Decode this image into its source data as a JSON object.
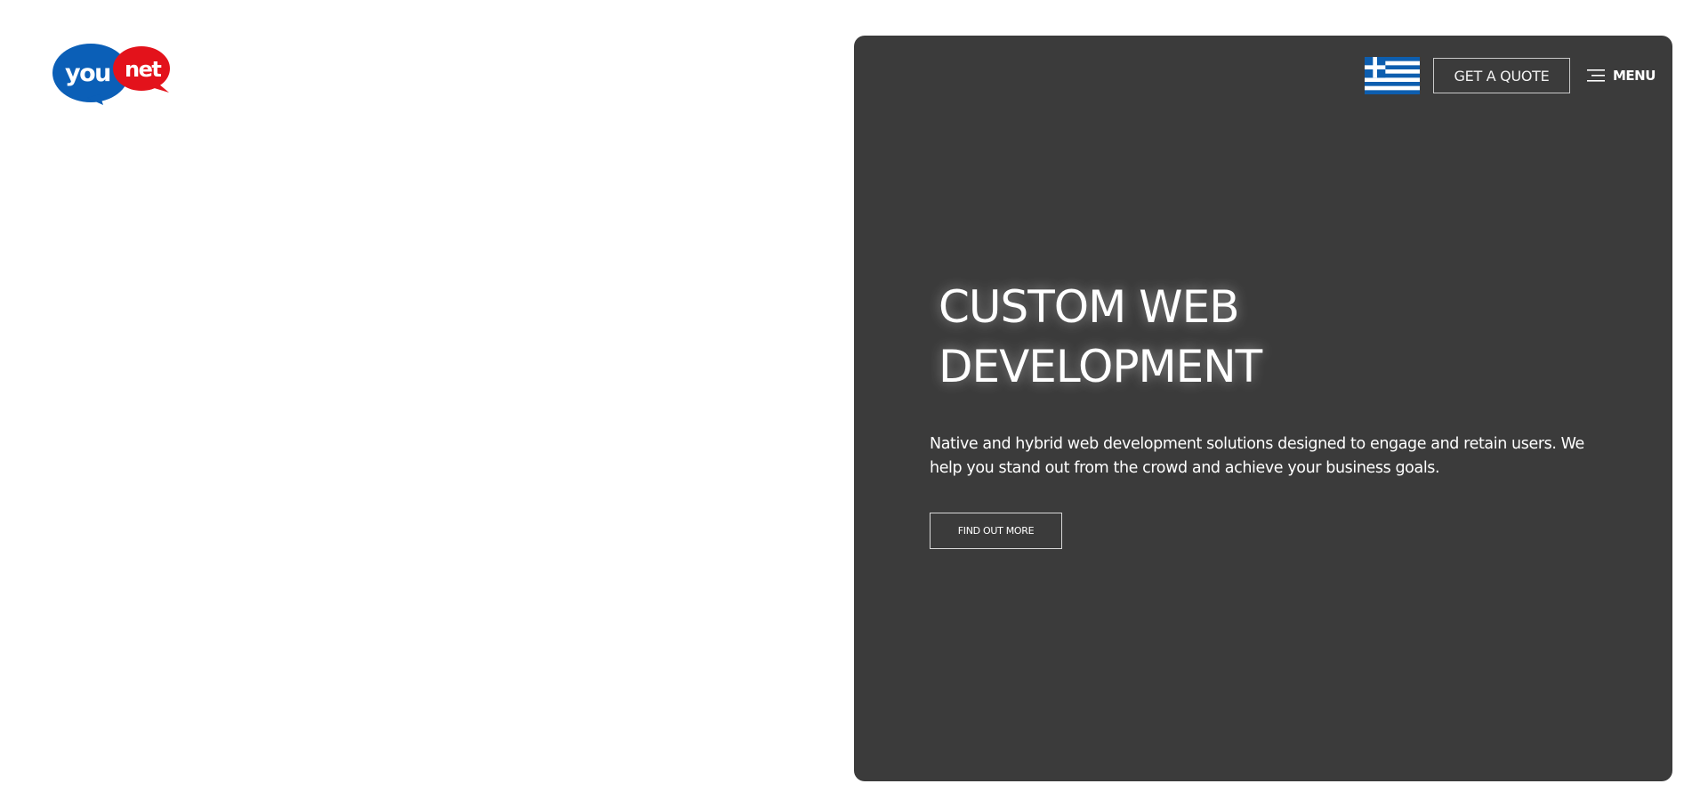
{
  "logo": {
    "text_left": "you",
    "text_right": "net",
    "color_blue": "#0b5fb7",
    "color_red": "#e3121b"
  },
  "nav": {
    "language_flag": "greece-flag-icon",
    "quote_label": "GET A QUOTE",
    "menu_icon": "hamburger-icon",
    "menu_label": "MENU"
  },
  "hero": {
    "background": "#3b3b3b",
    "title_line1": "CUSTOM WEB",
    "title_line2": "DEVELOPMENT",
    "subtitle_line1": "Native and hybrid web development solutions designed to engage and retain users. We",
    "subtitle_line2": "help you stand out from the crowd and achieve your business goals.",
    "cta_label": "FIND OUT MORE"
  }
}
